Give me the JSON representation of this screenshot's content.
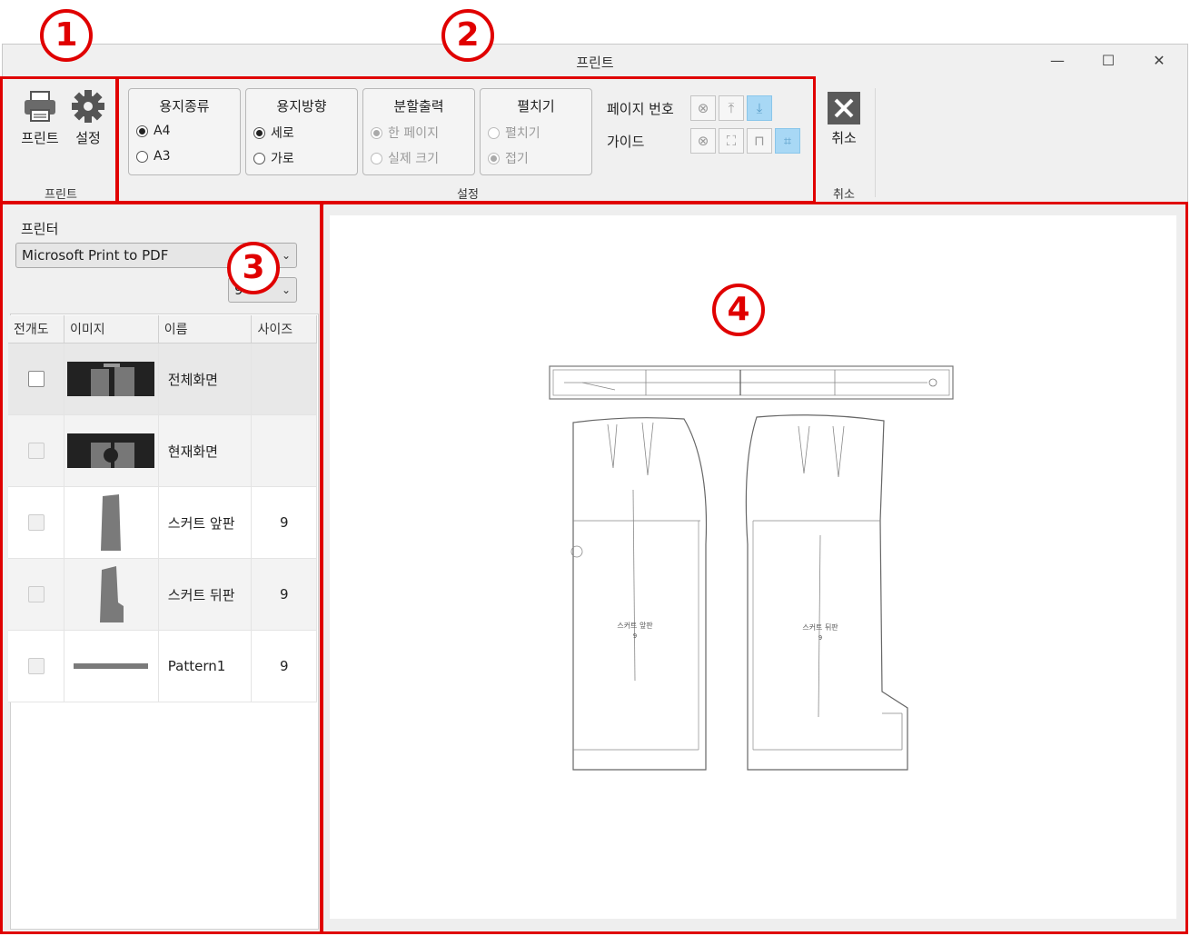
{
  "callouts": [
    "1",
    "2",
    "3",
    "4"
  ],
  "window": {
    "title": "프린트",
    "minimize": "—",
    "maximize": "☐",
    "close": "✕"
  },
  "ribbon": {
    "print_group": {
      "print_label": "프린트",
      "settings_label": "설정",
      "group_label": "프린트"
    },
    "paper_type": {
      "title": "용지종류",
      "options": [
        "A4",
        "A3"
      ],
      "selected": "A4"
    },
    "orientation": {
      "title": "용지방향",
      "options": [
        "세로",
        "가로"
      ],
      "selected": "세로"
    },
    "split": {
      "title": "분할출력",
      "options": [
        "한 페이지",
        "실제 크기"
      ],
      "selected": "한 페이지"
    },
    "unfold": {
      "title": "펼치기",
      "options": [
        "펼치기",
        "접기"
      ],
      "selected": "접기"
    },
    "page_number_label": "페이지 번호",
    "guide_label": "가이드",
    "settings_group_label": "설정",
    "cancel": {
      "label": "취소",
      "group_label": "취소"
    }
  },
  "sidebar": {
    "printer_label": "프린터",
    "printer_value": "Microsoft Print to PDF",
    "size_value": "9",
    "columns": [
      "전개도",
      "이미지",
      "이름",
      "사이즈"
    ],
    "rows": [
      {
        "name": "전체화면",
        "size": "",
        "selected": true
      },
      {
        "name": "현재화면",
        "size": ""
      },
      {
        "name": "스커트 앞판",
        "size": "9"
      },
      {
        "name": "스커트 뒤판",
        "size": "9"
      },
      {
        "name": "Pattern1",
        "size": "9"
      }
    ]
  },
  "preview": {
    "front_label": "스커트 앞판",
    "back_label": "스커트 뒤판",
    "size_mark": "9"
  },
  "colors": {
    "accent_blue": "#a8d8f5",
    "callout_red": "#e00000"
  }
}
